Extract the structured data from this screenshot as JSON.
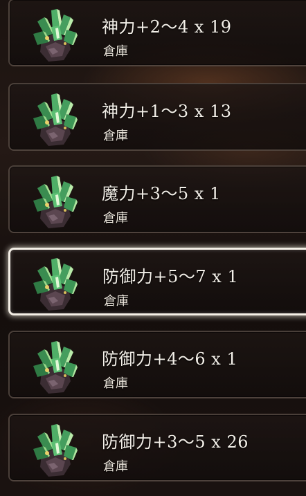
{
  "items": [
    {
      "name": "神力+2〜4 x 19",
      "location": "倉庫",
      "icon": "green-crystal-ore-icon",
      "selected": false
    },
    {
      "name": "神力+1〜3 x 13",
      "location": "倉庫",
      "icon": "green-crystal-ore-icon",
      "selected": false
    },
    {
      "name": "魔力+3〜5 x 1",
      "location": "倉庫",
      "icon": "green-crystal-ore-icon",
      "selected": false
    },
    {
      "name": "防御力+5〜7 x 1",
      "location": "倉庫",
      "icon": "green-crystal-ore-icon",
      "selected": true
    },
    {
      "name": "防御力+4〜6 x 1",
      "location": "倉庫",
      "icon": "green-crystal-ore-icon",
      "selected": false
    },
    {
      "name": "防御力+3〜5 x 26",
      "location": "倉庫",
      "icon": "green-crystal-ore-icon",
      "selected": false
    }
  ],
  "colors": {
    "crystal": "#3f9a57",
    "crystal_light": "#b6e6a4",
    "ore": "#4a3a40",
    "selection_border": "#f4efe6"
  }
}
